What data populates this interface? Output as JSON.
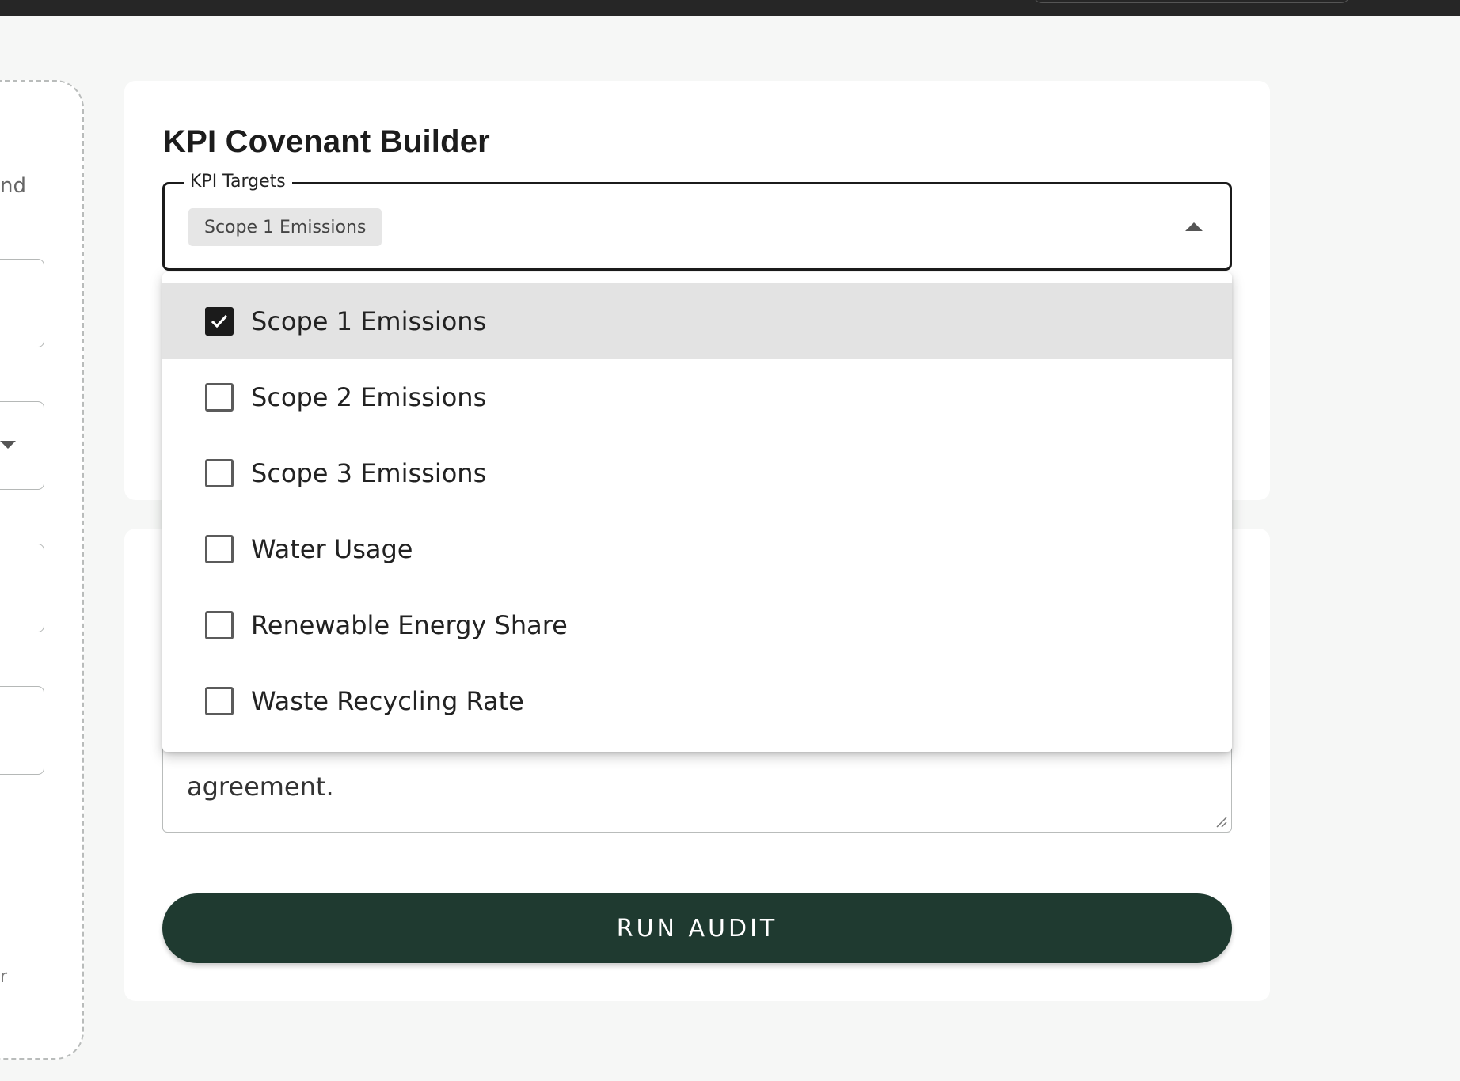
{
  "left_panel": {
    "snippet_text": "nd",
    "edge_glyph": "r"
  },
  "kpi_card": {
    "title": "KPI Covenant Builder",
    "field_label": "KPI Targets",
    "selected_chip": "Scope 1 Emissions",
    "menu_items": [
      {
        "label": "Scope 1 Emissions",
        "checked": true
      },
      {
        "label": "Scope 2 Emissions",
        "checked": false
      },
      {
        "label": "Scope 3 Emissions",
        "checked": false
      },
      {
        "label": "Water Usage",
        "checked": false
      },
      {
        "label": "Renewable Energy Share",
        "checked": false
      },
      {
        "label": "Waste Recycling Rate",
        "checked": false
      }
    ]
  },
  "audit_card": {
    "textarea_visible_text": "agreement.",
    "run_button_label": "RUN AUDIT"
  },
  "colors": {
    "accent": "#1f3a30",
    "page_background": "#f6f7f6",
    "selected_row": "#e3e3e3"
  },
  "icons": {
    "dropdown_open": "arrow-up-icon",
    "checkbox_checked": "check-icon"
  }
}
